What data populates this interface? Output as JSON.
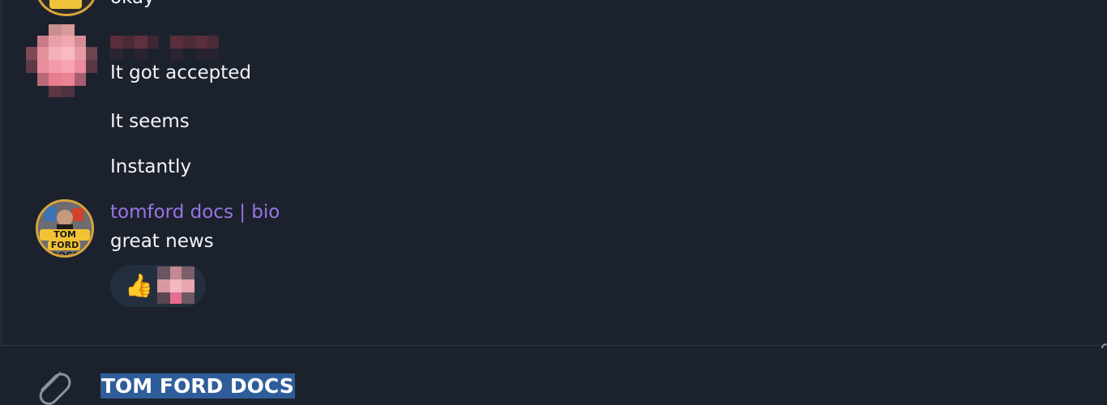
{
  "messages": [
    {
      "text": "okay"
    },
    {
      "sender": "",
      "text": "It got accepted"
    },
    {
      "text": "It seems"
    },
    {
      "text": "Instantly"
    },
    {
      "sender": "tomford docs | bio",
      "text": "great news",
      "reaction": {
        "emoji": "👍"
      }
    }
  ],
  "brand_avatar_label": [
    "TOM FORD",
    "DOCS"
  ],
  "composer": {
    "value": "TOM FORD DOCS"
  },
  "colors": {
    "background": "#1b222d",
    "sender_name": "#9b74e4",
    "message_text": "#f2f4f7",
    "reaction_pill": "#232f3e",
    "selection": "#2e5d9a"
  }
}
